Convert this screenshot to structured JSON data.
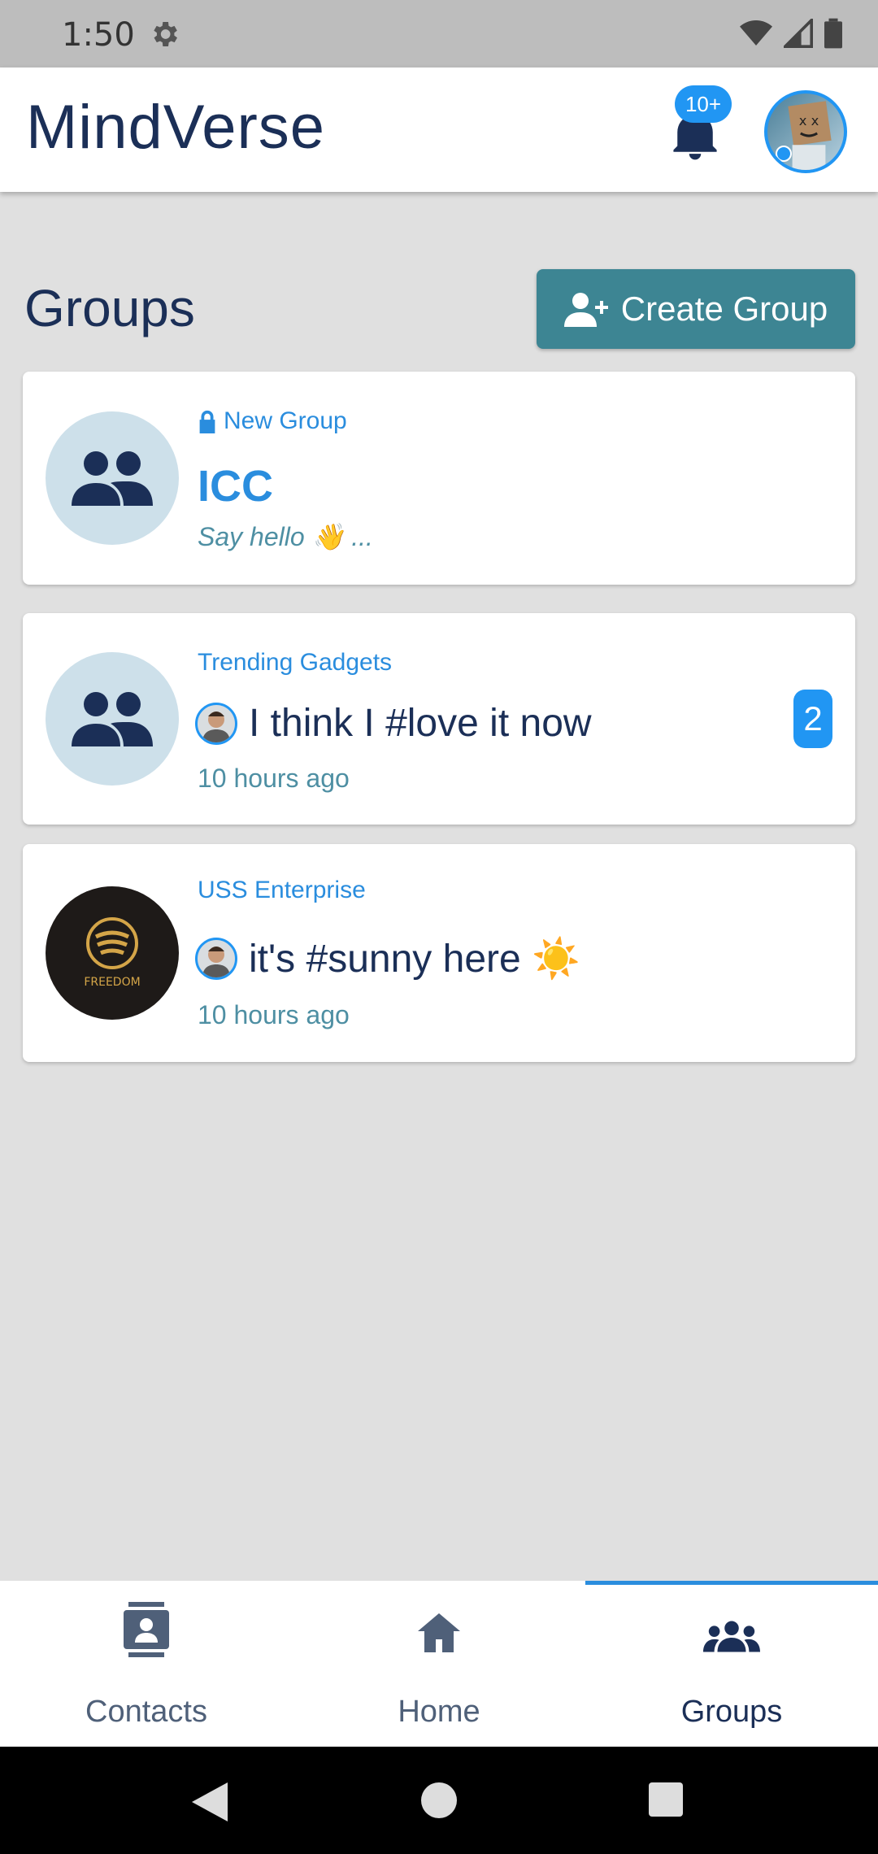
{
  "status_bar": {
    "time": "1:50",
    "icons": [
      "gear-icon",
      "wifi-icon",
      "signal-icon",
      "battery-icon"
    ]
  },
  "app_bar": {
    "title": "MindVerse",
    "notification_badge": "10+",
    "icons": [
      "bell-icon",
      "user-avatar"
    ]
  },
  "page": {
    "title": "Groups",
    "create_button": "Create Group",
    "create_icon": "add-user-icon"
  },
  "groups": [
    {
      "label": "New Group",
      "label_icon": "lock-icon",
      "name": "ICC",
      "preview": "Say hello 👋 ...",
      "avatar": "group-icon"
    },
    {
      "label": "Trending Gadgets",
      "message": "I think I #love it now",
      "time": "10 hours ago",
      "unread": "2",
      "avatar": "group-icon"
    },
    {
      "label": "USS Enterprise",
      "message": "it's #sunny here ☀️",
      "time": "10 hours ago",
      "avatar": "freedom-logo"
    }
  ],
  "logo": {
    "text": "FREEDOM"
  },
  "bottom_nav": {
    "items": [
      {
        "label": "Contacts",
        "icon": "contacts-icon"
      },
      {
        "label": "Home",
        "icon": "home-icon"
      },
      {
        "label": "Groups",
        "icon": "groups-icon",
        "active": true
      }
    ]
  },
  "colors": {
    "accent": "#2196f3",
    "primary_text": "#1b2f57",
    "button": "#3d8593",
    "background": "#e0e0e0"
  }
}
